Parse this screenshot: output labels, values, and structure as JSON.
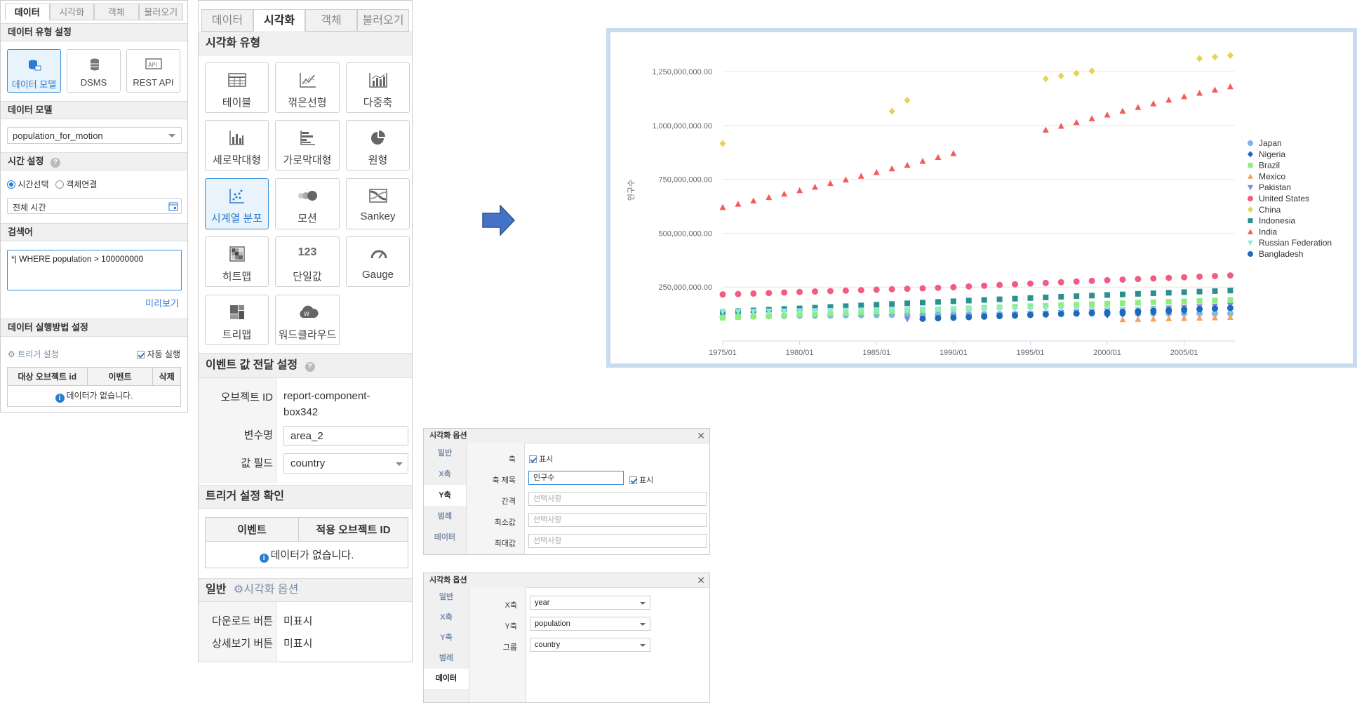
{
  "left_panel": {
    "tabs": [
      "데이터",
      "시각화",
      "객체",
      "불러오기"
    ],
    "active_tab": 0,
    "data_type": {
      "title": "데이터 유형 설정",
      "options": [
        {
          "label": "데이터 모델",
          "icon": "data-model-icon",
          "active": true
        },
        {
          "label": "DSMS",
          "icon": "database-icon",
          "active": false
        },
        {
          "label": "REST API",
          "icon": "rest-api-icon",
          "active": false
        }
      ]
    },
    "data_model": {
      "title": "데이터 모델",
      "value": "population_for_motion"
    },
    "time": {
      "title": "시간 설정",
      "radio_time": "시간선택",
      "radio_object": "객체연결",
      "range": "전체 시간"
    },
    "search": {
      "title": "검색어",
      "query": "*| WHERE population > 100000000",
      "preview": "미리보기"
    },
    "exec": {
      "title": "데이터 실행방법 설정",
      "trigger": "트리거 설정",
      "auto_run": "자동 실행",
      "columns": [
        "대상 오브젝트 id",
        "이벤트",
        "삭제"
      ],
      "empty": "데이터가 없습니다."
    }
  },
  "viz_panel": {
    "tabs": [
      "데이터",
      "시각화",
      "객체",
      "불러오기"
    ],
    "active_tab": 1,
    "type_title": "시각화 유형",
    "types": [
      {
        "label": "테이블",
        "icon": "table-icon"
      },
      {
        "label": "꺾은선형",
        "icon": "line-chart-icon"
      },
      {
        "label": "다중축",
        "icon": "multi-axis-icon"
      },
      {
        "label": "세로막대형",
        "icon": "column-chart-icon"
      },
      {
        "label": "가로막대형",
        "icon": "bar-chart-icon"
      },
      {
        "label": "원형",
        "icon": "pie-chart-icon"
      },
      {
        "label": "시계열 분포",
        "icon": "scatter-icon",
        "active": true
      },
      {
        "label": "모션",
        "icon": "motion-icon"
      },
      {
        "label": "Sankey",
        "icon": "sankey-icon"
      },
      {
        "label": "히트맵",
        "icon": "heatmap-icon"
      },
      {
        "label": "단일값",
        "icon": "single-value-icon",
        "glyph": "123"
      },
      {
        "label": "Gauge",
        "icon": "gauge-icon"
      },
      {
        "label": "트리맵",
        "icon": "treemap-icon"
      },
      {
        "label": "워드클라우드",
        "icon": "wordcloud-icon"
      }
    ],
    "event": {
      "title": "이벤트 값 전달 설정",
      "object_id_label": "오브젝트 ID",
      "object_id_value": "report-component-box342",
      "var_label": "변수명",
      "var_value": "area_2",
      "field_label": "값 필드",
      "field_value": "country"
    },
    "trigger_check": {
      "title": "트리거 설정 확인",
      "columns": [
        "이벤트",
        "적용 오브젝트 ID"
      ],
      "empty": "데이터가 없습니다."
    },
    "general": {
      "title": "일반",
      "options_link": "시각화 옵션",
      "download_label": "다운로드 버튼",
      "download_value": "미표시",
      "detail_label": "상세보기 버튼",
      "detail_value": "미표시"
    }
  },
  "options_window_1": {
    "title": "시각화 옵션",
    "tabs": [
      "일반",
      "X축",
      "Y축",
      "범례",
      "데이터"
    ],
    "current_tab": 2,
    "axis_label": "축",
    "axis_show": "표시",
    "axis_title_label": "축 제목",
    "axis_title_value": "인구수",
    "axis_title_show": "표시",
    "interval_label": "간격",
    "min_label": "최소값",
    "max_label": "최대값",
    "placeholder": "선택사항"
  },
  "options_window_2": {
    "title": "시각화 옵션",
    "tabs": [
      "일반",
      "X축",
      "Y축",
      "범례",
      "데이터"
    ],
    "current_tab": 4,
    "x_label": "X축",
    "x_value": "year",
    "y_label": "Y축",
    "y_value": "population",
    "group_label": "그룹",
    "group_value": "country"
  },
  "colors": {
    "accent": "#2b7bd0",
    "arrow": "#4472c4",
    "chart_border": "#c9dcef"
  },
  "chart_data": {
    "type": "scatter",
    "ylabel": "인구수",
    "y_ticks": [
      "250,000,000.00",
      "500,000,000.00",
      "750,000,000.00",
      "1,000,000,000.00",
      "1,250,000,000.00"
    ],
    "ylim": [
      0,
      1400000000
    ],
    "x_ticks": [
      "1975/01",
      "1980/01",
      "1985/01",
      "1990/01",
      "1995/01",
      "2000/01",
      "2005/01"
    ],
    "xlim": [
      1975,
      2008.3
    ],
    "grid": true,
    "legend_position": "right",
    "series": [
      {
        "name": "Japan",
        "color": "#7cb5ec",
        "marker": "circle",
        "x": [
          1975,
          1976,
          1977,
          1978,
          1979,
          1980,
          1981,
          1982,
          1983,
          1984,
          1985,
          1986,
          1987,
          1988,
          1989,
          1990,
          1991,
          1992,
          1993,
          1994,
          1995,
          1996,
          1997,
          1998,
          1999,
          2000,
          2001,
          2002,
          2003,
          2004,
          2005,
          2006,
          2007,
          2008
        ],
        "y": [
          111500000,
          112800000,
          113900000,
          114900000,
          115900000,
          116800000,
          117600000,
          118400000,
          119300000,
          120000000,
          120800000,
          121500000,
          122100000,
          122600000,
          123100000,
          123500000,
          124000000,
          124500000,
          124800000,
          125100000,
          125400000,
          125800000,
          126100000,
          126400000,
          126600000,
          126800000,
          127000000,
          127200000,
          127400000,
          127500000,
          127700000,
          127800000,
          127800000,
          127700000
        ]
      },
      {
        "name": "Nigeria",
        "color": "#1f5fd6",
        "marker": "diamond",
        "x": [
          2000,
          2001,
          2002,
          2003,
          2004,
          2005,
          2006,
          2007,
          2008
        ],
        "y": [
          122000000,
          125500000,
          129000000,
          132500000,
          136000000,
          139500000,
          143500000,
          147500000,
          151500000
        ]
      },
      {
        "name": "Brazil",
        "color": "#90ed7d",
        "marker": "square",
        "x": [
          1975,
          1976,
          1977,
          1978,
          1979,
          1980,
          1981,
          1982,
          1983,
          1984,
          1985,
          1986,
          1987,
          1988,
          1989,
          1990,
          1991,
          1992,
          1993,
          1994,
          1995,
          1996,
          1997,
          1998,
          1999,
          2000,
          2001,
          2002,
          2003,
          2004,
          2005,
          2006,
          2007,
          2008
        ],
        "y": [
          108000000,
          110700000,
          113400000,
          116100000,
          118800000,
          121600000,
          124400000,
          127200000,
          130000000,
          132800000,
          135600000,
          138300000,
          141000000,
          143600000,
          146200000,
          148800000,
          151400000,
          153900000,
          156400000,
          158900000,
          161300000,
          163700000,
          166000000,
          168300000,
          170600000,
          173000000,
          175300000,
          177600000,
          179900000,
          182100000,
          184200000,
          186200000,
          188200000,
          190100000
        ]
      },
      {
        "name": "Mexico",
        "color": "#f7a35c",
        "marker": "triangle",
        "x": [
          2001,
          2002,
          2003,
          2004,
          2005,
          2006,
          2007,
          2008
        ],
        "y": [
          100000000,
          101500000,
          103000000,
          104500000,
          106000000,
          107500000,
          109000000,
          110500000
        ]
      },
      {
        "name": "Pakistan",
        "color": "#8085e9",
        "marker": "triangle-down",
        "x": [
          1987,
          1988,
          1989,
          1990,
          1991,
          1992,
          1993,
          1994,
          1995,
          1996,
          1997,
          1998,
          1999,
          2000,
          2001,
          2002,
          2003,
          2004,
          2005,
          2006,
          2007,
          2008
        ],
        "y": [
          100500000,
          103500000,
          106500000,
          109500000,
          112500000,
          115500000,
          118500000,
          121500000,
          124500000,
          127500000,
          130500000,
          133500000,
          136500000,
          139500000,
          142500000,
          145500000,
          148500000,
          151500000,
          154500000,
          157500000,
          160500000,
          163500000
        ]
      },
      {
        "name": "United States",
        "color": "#f15c80",
        "marker": "circle",
        "x": [
          1975,
          1976,
          1977,
          1978,
          1979,
          1980,
          1981,
          1982,
          1983,
          1984,
          1985,
          1986,
          1987,
          1988,
          1989,
          1990,
          1991,
          1992,
          1993,
          1994,
          1995,
          1996,
          1997,
          1998,
          1999,
          2000,
          2001,
          2002,
          2003,
          2004,
          2005,
          2006,
          2007,
          2008
        ],
        "y": [
          216000000,
          218000000,
          220000000,
          222500000,
          225000000,
          227200000,
          229500000,
          231700000,
          233800000,
          235800000,
          237900000,
          240100000,
          242300000,
          244500000,
          246800000,
          249600000,
          253000000,
          256500000,
          259900000,
          263100000,
          266300000,
          269400000,
          272600000,
          275800000,
          279000000,
          282200000,
          285000000,
          287600000,
          290100000,
          292800000,
          295500000,
          298400000,
          301200000,
          304100000
        ]
      },
      {
        "name": "China",
        "color": "#e4d354",
        "marker": "diamond",
        "x": [
          1975,
          1986,
          1987,
          1996,
          1997,
          1998,
          1999,
          2006,
          2007,
          2008
        ],
        "y": [
          916000000,
          1066000000,
          1117000000,
          1217000000,
          1230000000,
          1242000000,
          1253000000,
          1311000000,
          1318000000,
          1325000000
        ]
      },
      {
        "name": "Indonesia",
        "color": "#2b908f",
        "marker": "square",
        "x": [
          1975,
          1976,
          1977,
          1978,
          1979,
          1980,
          1981,
          1982,
          1983,
          1984,
          1985,
          1986,
          1987,
          1988,
          1989,
          1990,
          1991,
          1992,
          1993,
          1994,
          1995,
          1996,
          1997,
          1998,
          1999,
          2000,
          2001,
          2002,
          2003,
          2004,
          2005,
          2006,
          2007,
          2008
        ],
        "y": [
          135000000,
          138400000,
          141800000,
          145300000,
          148700000,
          151000000,
          154500000,
          158000000,
          161400000,
          164800000,
          168200000,
          171500000,
          174800000,
          178000000,
          181200000,
          184300000,
          187400000,
          190400000,
          193400000,
          196400000,
          199400000,
          202300000,
          205200000,
          208000000,
          210700000,
          213400000,
          216100000,
          218700000,
          221300000,
          223900000,
          226500000,
          229100000,
          231600000,
          234000000
        ]
      },
      {
        "name": "India",
        "color": "#f45b5b",
        "marker": "triangle",
        "x": [
          1975,
          1976,
          1977,
          1978,
          1979,
          1980,
          1981,
          1982,
          1983,
          1984,
          1985,
          1986,
          1987,
          1988,
          1989,
          1990,
          1996,
          1997,
          1998,
          1999,
          2000,
          2001,
          2002,
          2003,
          2004,
          2005,
          2006,
          2007,
          2008
        ],
        "y": [
          621000000,
          636000000,
          651000000,
          667000000,
          683000000,
          699000000,
          715000000,
          732000000,
          749000000,
          766000000,
          783000000,
          800000000,
          817000000,
          835000000,
          853000000,
          871000000,
          980000000,
          998000000,
          1015000000,
          1033000000,
          1050000000,
          1068000000,
          1085000000,
          1102000000,
          1119000000,
          1135000000,
          1151000000,
          1166000000,
          1181000000
        ]
      },
      {
        "name": "Russian Federation",
        "color": "#91e8e1",
        "marker": "triangle-down",
        "x": [
          1975,
          1976,
          1977,
          1978,
          1979,
          1980,
          1981,
          1982,
          1983,
          1984,
          1985,
          1986,
          1987,
          1988,
          1989,
          1990,
          1991,
          1992,
          1993,
          1994,
          1995,
          1996,
          1997,
          1998,
          1999,
          2000,
          2001,
          2002,
          2003,
          2004,
          2005,
          2006,
          2007,
          2008
        ],
        "y": [
          134000000,
          135000000,
          136000000,
          137000000,
          137500000,
          138500000,
          139300000,
          140100000,
          141000000,
          142000000,
          142900000,
          144000000,
          145100000,
          146300000,
          147300000,
          148300000,
          148600000,
          148700000,
          148600000,
          148400000,
          148100000,
          147800000,
          147500000,
          147100000,
          146600000,
          146200000,
          145900000,
          145300000,
          144800000,
          144300000,
          143800000,
          143300000,
          142900000,
          142700000
        ]
      },
      {
        "name": "Bangladesh",
        "color": "#1b6bb5",
        "marker": "circle",
        "x": [
          1988,
          1989,
          1990,
          1991,
          1992,
          1993,
          1994,
          1995,
          1996,
          1997,
          1998,
          1999,
          2000,
          2001,
          2002,
          2003,
          2004,
          2005,
          2006,
          2007,
          2008
        ],
        "y": [
          103000000,
          105500000,
          108000000,
          110500000,
          113000000,
          115500000,
          118000000,
          120500000,
          123000000,
          125500000,
          128000000,
          130500000,
          133000000,
          135500000,
          138000000,
          140500000,
          143000000,
          145500000,
          148000000,
          150500000,
          153000000
        ]
      }
    ]
  }
}
